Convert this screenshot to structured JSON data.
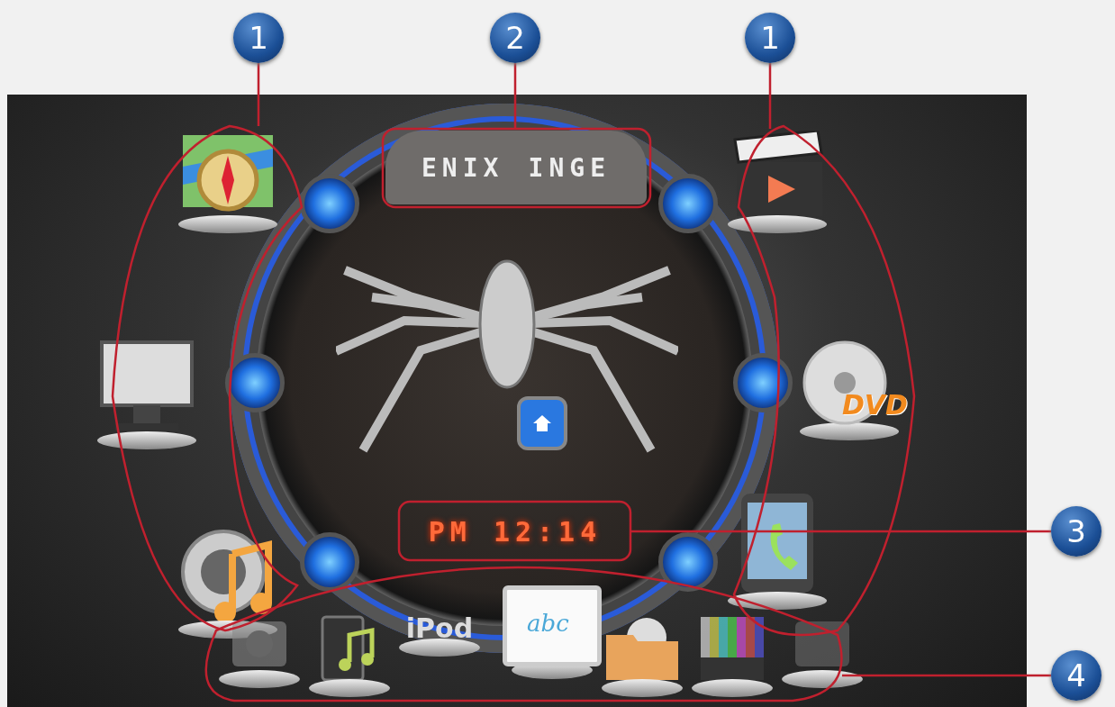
{
  "callouts": [
    {
      "number": "1",
      "kind": "left"
    },
    {
      "number": "2",
      "kind": "banner"
    },
    {
      "number": "1",
      "kind": "right"
    },
    {
      "number": "3",
      "kind": "clock"
    },
    {
      "number": "4",
      "kind": "dock"
    }
  ],
  "banner": {
    "left": "ENIX",
    "right": "INGE"
  },
  "clock": "PM 12:14",
  "left_apps": [
    {
      "kind": "map"
    },
    {
      "kind": "monitor"
    },
    {
      "kind": "speaker"
    }
  ],
  "right_apps": [
    {
      "kind": "clapper"
    },
    {
      "kind": "disc",
      "label": "DVD"
    },
    {
      "kind": "phone"
    }
  ],
  "dock": [
    {
      "kind": "camera"
    },
    {
      "kind": "tablet"
    },
    {
      "kind": "text",
      "label": "iPod"
    },
    {
      "kind": "board",
      "label": "abc"
    },
    {
      "kind": "folder"
    },
    {
      "kind": "bars"
    },
    {
      "kind": "faint"
    }
  ]
}
